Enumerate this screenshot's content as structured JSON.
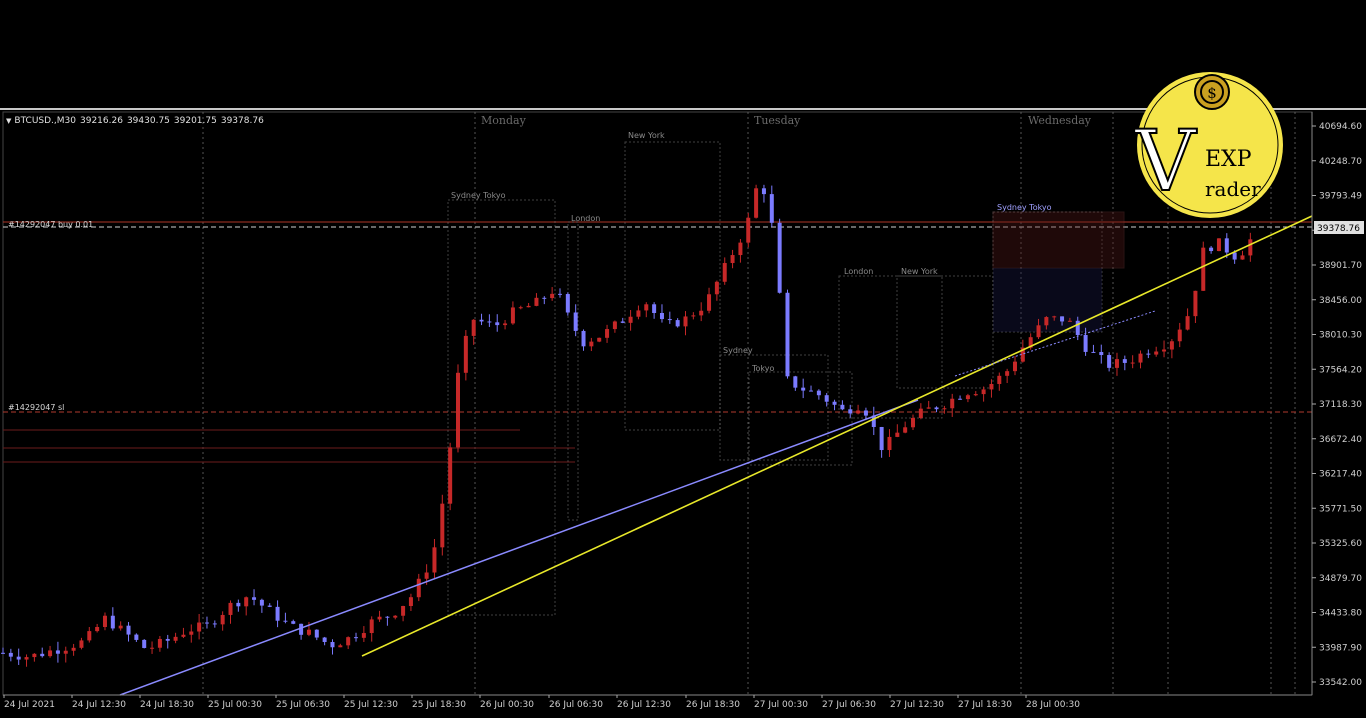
{
  "header": {
    "symbol": "BTCUSD.,M30",
    "open": "39216.26",
    "high": "39430.75",
    "low": "39201.75",
    "close": "39378.76"
  },
  "day_labels": [
    "Monday",
    "Tuesday",
    "Wednesday"
  ],
  "order_lines": {
    "buy": "#14292047 buy 0.01",
    "sl": "#14292047 sl"
  },
  "current_price_label": "39378.76",
  "session_labels": [
    "Sydney Tokyo",
    "London",
    "New York",
    "Sydney",
    "Tokyo",
    "London",
    "New York",
    "Sydney Tokyo"
  ],
  "logo": {
    "big_letter": "V",
    "exp": "EXP",
    "rest": "rader"
  },
  "colors": {
    "bull": "#c62828",
    "bear": "#7b7bff",
    "trend_blue": "#8a8aff",
    "trend_yellow": "#e8e82a",
    "grid": "#8a8a8a",
    "logo_yellow": "#f5e54a"
  },
  "chart_data": {
    "type": "candlestick",
    "ylim": [
      33400,
      41000
    ],
    "y_ticks": [
      "40694.60",
      "40248.70",
      "39793.49",
      "39347.60",
      "38901.70",
      "38456.00",
      "38010.30",
      "37564.20",
      "37118.30",
      "36672.40",
      "36217.40",
      "35771.50",
      "35325.60",
      "34879.70",
      "34433.80",
      "33987.90",
      "33542.00"
    ],
    "x_ticks": [
      "24 Jul 2021",
      "24 Jul 12:30",
      "24 Jul 18:30",
      "25 Jul 00:30",
      "25 Jul 06:30",
      "25 Jul 12:30",
      "25 Jul 18:30",
      "26 Jul 00:30",
      "26 Jul 06:30",
      "26 Jul 12:30",
      "26 Jul 18:30",
      "27 Jul 00:30",
      "27 Jul 06:30",
      "27 Jul 12:30",
      "27 Jul 18:30",
      "28 Jul 00:30"
    ],
    "price_path": [
      [
        0,
        33950
      ],
      [
        8,
        33900
      ],
      [
        16,
        34000
      ],
      [
        24,
        34100
      ],
      [
        30,
        34400
      ],
      [
        36,
        34200
      ],
      [
        42,
        34000
      ],
      [
        48,
        34100
      ],
      [
        54,
        34250
      ],
      [
        60,
        34300
      ],
      [
        66,
        34550
      ],
      [
        72,
        34700
      ],
      [
        78,
        34500
      ],
      [
        84,
        34300
      ],
      [
        90,
        34200
      ],
      [
        96,
        34050
      ],
      [
        102,
        34150
      ],
      [
        108,
        34350
      ],
      [
        114,
        34450
      ],
      [
        120,
        34700
      ],
      [
        126,
        35200
      ],
      [
        130,
        36200
      ],
      [
        134,
        37800
      ],
      [
        138,
        38300
      ],
      [
        144,
        38200
      ],
      [
        150,
        38400
      ],
      [
        156,
        38500
      ],
      [
        162,
        38700
      ],
      [
        166,
        38300
      ],
      [
        170,
        38000
      ],
      [
        176,
        38100
      ],
      [
        182,
        38300
      ],
      [
        188,
        38550
      ],
      [
        194,
        38200
      ],
      [
        200,
        38300
      ],
      [
        206,
        38500
      ],
      [
        212,
        39000
      ],
      [
        218,
        39500
      ],
      [
        222,
        40200
      ],
      [
        226,
        39400
      ],
      [
        230,
        37500
      ],
      [
        234,
        37400
      ],
      [
        240,
        37300
      ],
      [
        246,
        37100
      ],
      [
        252,
        37200
      ],
      [
        258,
        36600
      ],
      [
        264,
        36900
      ],
      [
        270,
        37100
      ],
      [
        276,
        37200
      ],
      [
        282,
        37350
      ],
      [
        288,
        37400
      ],
      [
        294,
        37600
      ],
      [
        300,
        38000
      ],
      [
        306,
        38300
      ],
      [
        312,
        38300
      ],
      [
        318,
        37900
      ],
      [
        324,
        37700
      ],
      [
        330,
        37750
      ],
      [
        336,
        37900
      ],
      [
        342,
        38000
      ],
      [
        348,
        38400
      ],
      [
        352,
        39200
      ],
      [
        356,
        39300
      ],
      [
        362,
        39100
      ],
      [
        366,
        39350
      ]
    ],
    "sessions_note": "Sydney Tokyo / London / New York session boxes"
  }
}
